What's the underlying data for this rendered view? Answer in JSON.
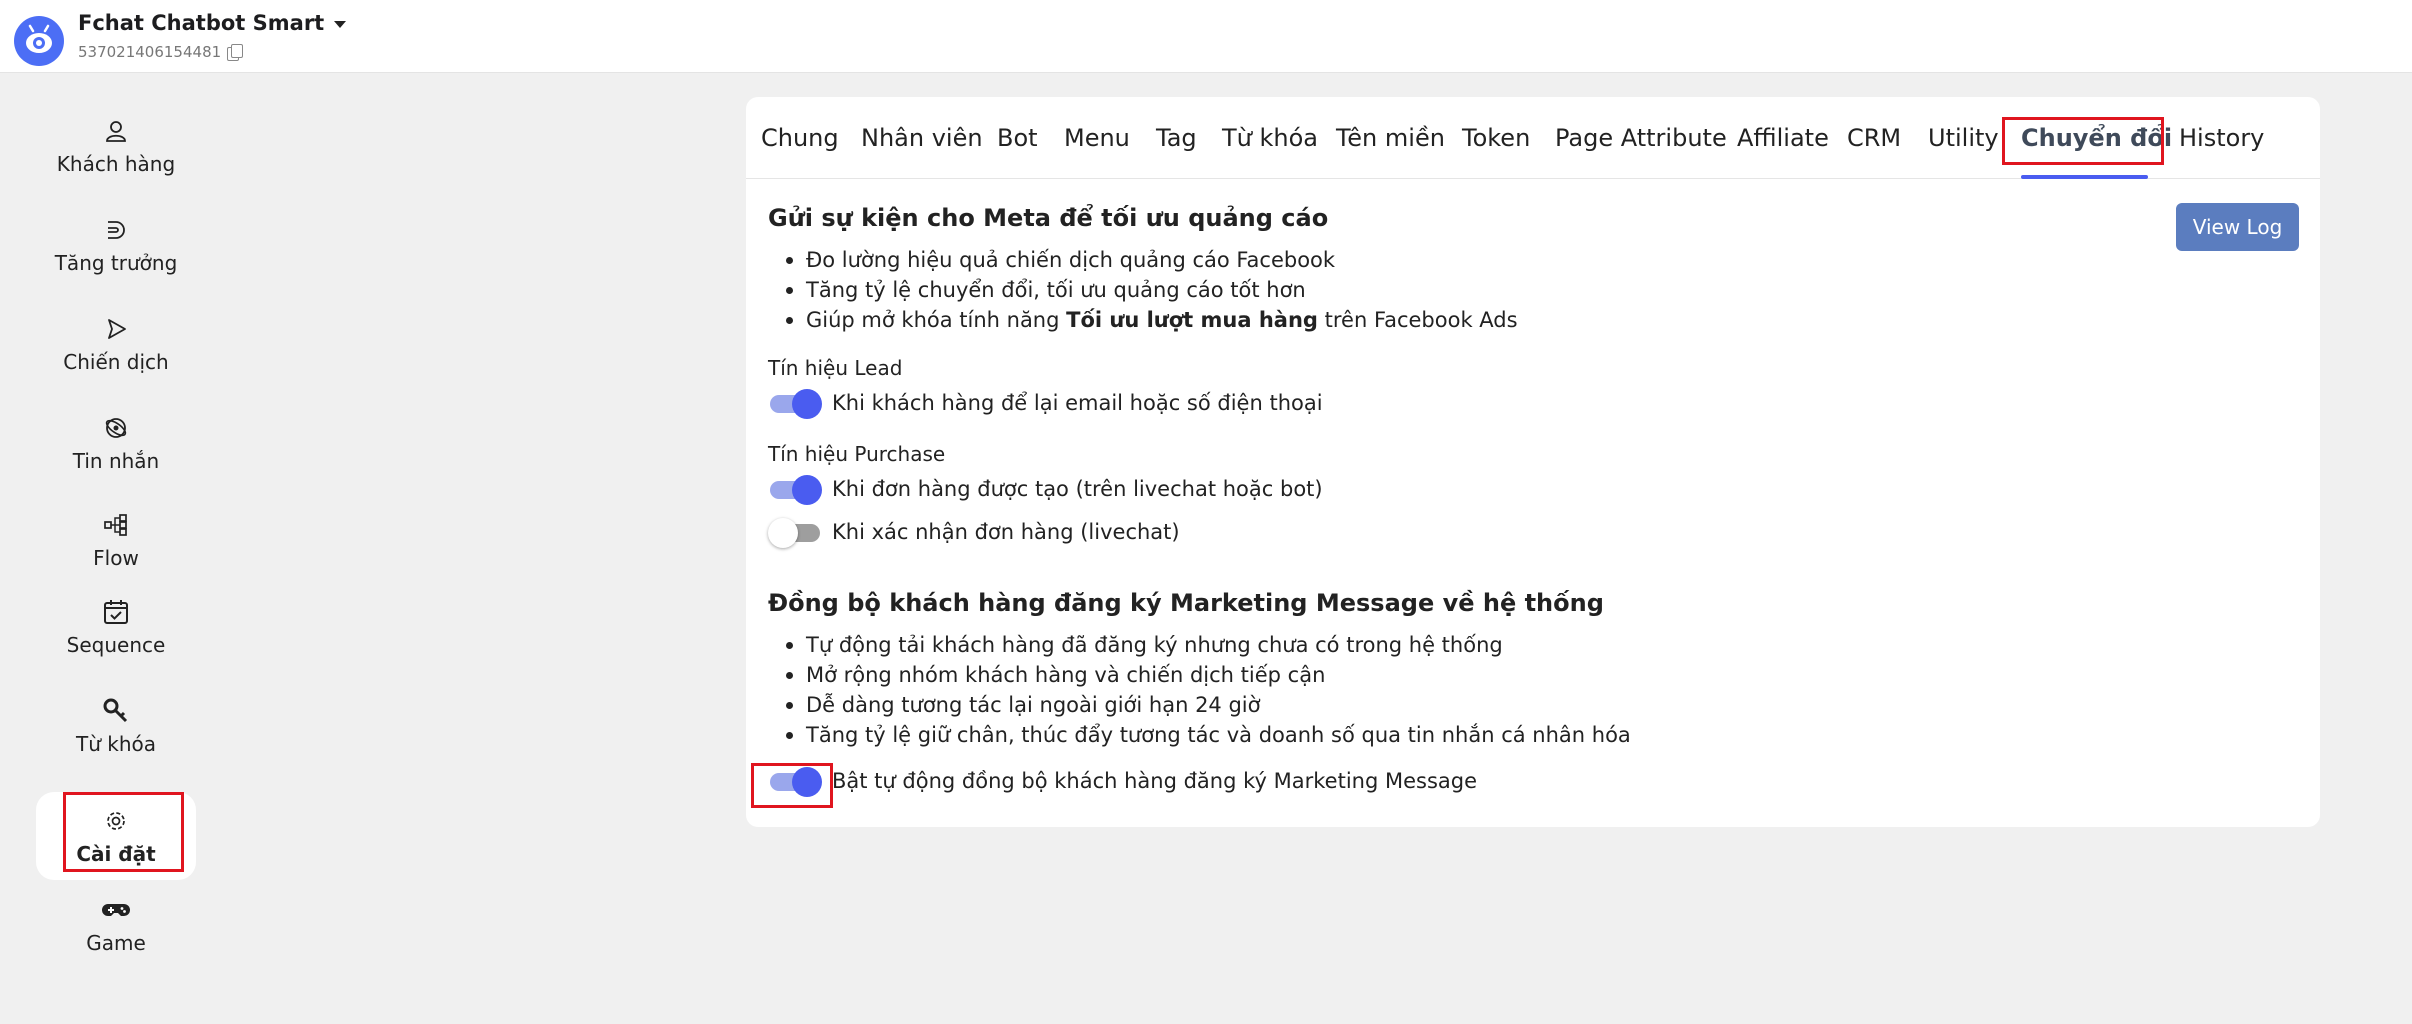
{
  "header": {
    "app_title": "Fchat Chatbot Smart",
    "page_id": "537021406154481",
    "logo_icon": "robot-eye-icon",
    "accent_color": "#4c6ef5"
  },
  "sidebar": {
    "items": [
      {
        "label": "Khách hàng",
        "icon": "user-icon"
      },
      {
        "label": "Tăng trưởng",
        "icon": "growth-icon"
      },
      {
        "label": "Chiến dịch",
        "icon": "send-icon"
      },
      {
        "label": "Tin nhắn",
        "icon": "message-icon"
      },
      {
        "label": "Flow",
        "icon": "flow-icon"
      },
      {
        "label": "Sequence",
        "icon": "calendar-check-icon"
      },
      {
        "label": "Từ khóa",
        "icon": "key-icon"
      },
      {
        "label": "Cài đặt",
        "icon": "gear-icon",
        "active": true
      },
      {
        "label": "Game",
        "icon": "gamepad-icon"
      }
    ]
  },
  "tabs": [
    {
      "label": "Chung"
    },
    {
      "label": "Nhân viên"
    },
    {
      "label": "Bot"
    },
    {
      "label": "Menu"
    },
    {
      "label": "Tag"
    },
    {
      "label": "Từ khóa"
    },
    {
      "label": "Tên miền"
    },
    {
      "label": "Token"
    },
    {
      "label": "Page Attribute"
    },
    {
      "label": "Affiliate"
    },
    {
      "label": "CRM"
    },
    {
      "label": "Utility"
    },
    {
      "label": "Chuyển đổi",
      "active": true
    },
    {
      "label": "History"
    }
  ],
  "view_log_label": "View Log",
  "meta_section": {
    "title": "Gửi sự kiện cho Meta để tối ưu quảng cáo",
    "bullet_1": "Đo lường hiệu quả chiến dịch quảng cáo Facebook",
    "bullet_2": "Tăng tỷ lệ chuyển đổi, tối ưu quảng cáo tốt hơn",
    "bullet_3_prefix": "Giúp mở khóa tính năng ",
    "bullet_3_bold": "Tối ưu lượt mua hàng",
    "bullet_3_suffix": " trên Facebook Ads",
    "lead_label": "Tín hiệu Lead",
    "lead_toggle": {
      "label": "Khi khách hàng để lại email hoặc số điện thoại",
      "on": true
    },
    "purchase_label": "Tín hiệu Purchase",
    "purchase_toggle_1": {
      "label": "Khi đơn hàng được tạo (trên livechat hoặc bot)",
      "on": true
    },
    "purchase_toggle_2": {
      "label": "Khi xác nhận đơn hàng (livechat)",
      "on": false
    }
  },
  "sync_section": {
    "title": "Đồng bộ khách hàng đăng ký Marketing Message về hệ thống",
    "bullets": [
      "Tự động tải khách hàng đã đăng ký nhưng chưa có trong hệ thống",
      "Mở rộng nhóm khách hàng và chiến dịch tiếp cận",
      "Dễ dàng tương tác lại ngoài giới hạn 24 giờ",
      "Tăng tỷ lệ giữ chân, thúc đẩy tương tác và doanh số qua tin nhắn cá nhân hóa"
    ],
    "sync_toggle": {
      "label": "Bật tự động đồng bộ khách hàng đăng ký Marketing Message",
      "on": true
    }
  },
  "colors": {
    "toggle_on": "#4a5cf0",
    "highlight_box": "#e0151f",
    "view_log_bg": "#5b7dbf"
  }
}
